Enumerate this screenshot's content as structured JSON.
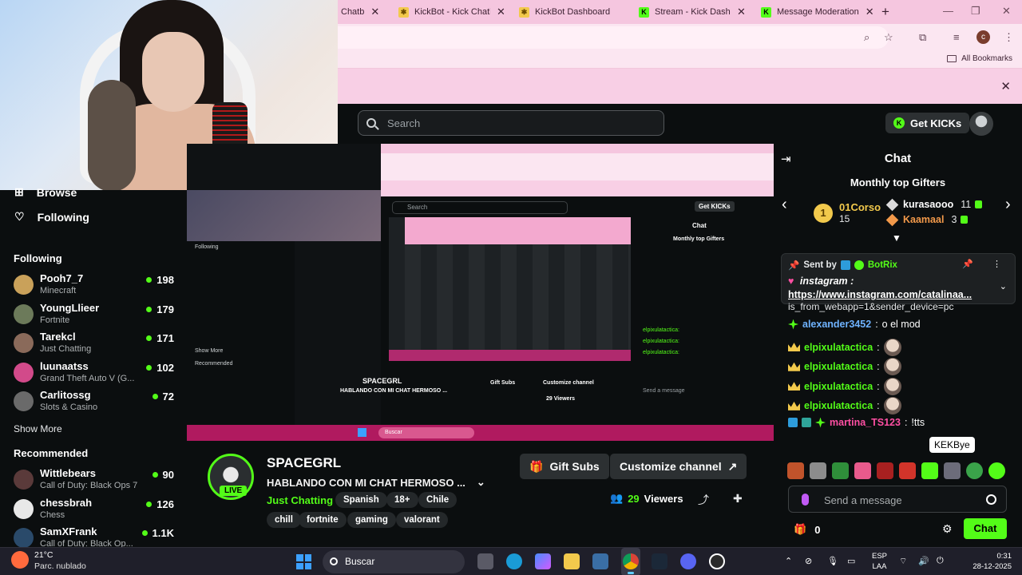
{
  "browser": {
    "tabs": [
      {
        "label": "Chatb",
        "favicon": "kickbot",
        "partial": true
      },
      {
        "label": "KickBot - Kick Chatb",
        "favicon": "kickbot"
      },
      {
        "label": "KickBot Dashboard",
        "favicon": "kickbot"
      },
      {
        "label": "Stream - Kick Dashb",
        "favicon": "kick"
      },
      {
        "label": "Message Moderation",
        "favicon": "kick"
      }
    ],
    "new_tab": "+",
    "profile_initial": "c",
    "all_bookmarks": "All Bookmarks"
  },
  "header": {
    "search_placeholder": "Search",
    "get_kicks": "Get KICKs"
  },
  "sidebar": {
    "browse": "Browse",
    "following_nav": "Following",
    "following_title": "Following",
    "following": [
      {
        "name": "Pooh7_7",
        "game": "Minecraft",
        "viewers": "198",
        "color": "#c9a15a"
      },
      {
        "name": "YoungLlieer",
        "game": "Fortnite",
        "viewers": "179",
        "color": "#6c7a5a"
      },
      {
        "name": "Tarekcl",
        "game": "Just Chatting",
        "viewers": "171",
        "color": "#8a6a5a"
      },
      {
        "name": "luunaatss",
        "game": "Grand Theft Auto V (G...",
        "viewers": "102",
        "color": "#d24a8a"
      },
      {
        "name": "Carlitossg",
        "game": "Slots & Casino",
        "viewers": "72",
        "color": "#6a6a6a"
      }
    ],
    "show_more": "Show More",
    "recommended_title": "Recommended",
    "recommended": [
      {
        "name": "Wittlebears",
        "game": "Call of Duty: Black Ops 7",
        "viewers": "90",
        "color": "#5a3a3a"
      },
      {
        "name": "chessbrah",
        "game": "Chess",
        "viewers": "126",
        "color": "#e8e8e8"
      },
      {
        "name": "SamXFrank",
        "game": "Call of Duty: Black Op...",
        "viewers": "1.1K",
        "color": "#2a4a6a"
      }
    ]
  },
  "capture": {
    "search": "Search",
    "get_kicks": "Get KICKs",
    "chat": "Chat",
    "gifters": "Monthly top Gifters",
    "streamer": "SPACEGRL",
    "title": "HABLANDO CON MI CHAT HERMOSO ...",
    "gift_subs": "Gift Subs",
    "customize": "Customize channel",
    "viewers": "29 Viewers",
    "taskbar_search": "Buscar",
    "sidebar_following": "Following",
    "sidebar_recommended": "Recommended",
    "sidebar_showmore": "Show More",
    "chat_input": "Send a message"
  },
  "channel": {
    "name": "SPACEGRL",
    "live": "LIVE",
    "title": "HABLANDO CON MI CHAT HERMOSO ...",
    "category": "Just Chatting",
    "tags_primary": [
      "Spanish",
      "18+",
      "Chile"
    ],
    "tags_secondary": [
      "chill",
      "fortnite",
      "gaming",
      "valorant"
    ],
    "gift_subs": "Gift Subs",
    "customize": "Customize channel",
    "viewers_count": "29",
    "viewers_label": "Viewers"
  },
  "chat": {
    "title": "Chat",
    "gifters_title": "Monthly top Gifters",
    "top_gifter": {
      "rank": "1",
      "name": "01Corso",
      "count": "15"
    },
    "gifters": [
      {
        "name": "kurasaooo",
        "count": "11",
        "color": "#dbdbdb"
      },
      {
        "name": "Kaamaal",
        "count": "3",
        "color": "#f2994a"
      }
    ],
    "pinned": {
      "sent_by": "Sent by",
      "bot": "BotRix",
      "line1": "instagram :",
      "link": "https://www.instagram.com/catalinaa...",
      "overflow": "is_from_webapp=1&sender_device=pc"
    },
    "messages": [
      {
        "user": "alexander3452",
        "color": "#6fb3ff",
        "text": "o el mod",
        "badge": "star"
      },
      {
        "user": "elpixulatactica",
        "color": "#53fc18",
        "text": "",
        "badge": "crown"
      },
      {
        "user": "elpixulatactica",
        "color": "#53fc18",
        "text": "",
        "badge": "crown"
      },
      {
        "user": "elpixulatactica",
        "color": "#53fc18",
        "text": "",
        "badge": "crown"
      },
      {
        "user": "elpixulatactica",
        "color": "#53fc18",
        "text": "",
        "badge": "crown"
      },
      {
        "user": "martina_TS123",
        "color": "#ff4fa3",
        "text": "!tts",
        "badge": "multi"
      }
    ],
    "tooltip": "KEKBye",
    "input_placeholder": "Send a message",
    "kicks_count": "0",
    "chat_button": "Chat"
  },
  "taskbar": {
    "weather_temp": "21°C",
    "weather_desc": "Parc. nublado",
    "search": "Buscar",
    "lang1": "ESP",
    "lang2": "LAA",
    "time": "0:31",
    "date": "28-12-2025"
  }
}
